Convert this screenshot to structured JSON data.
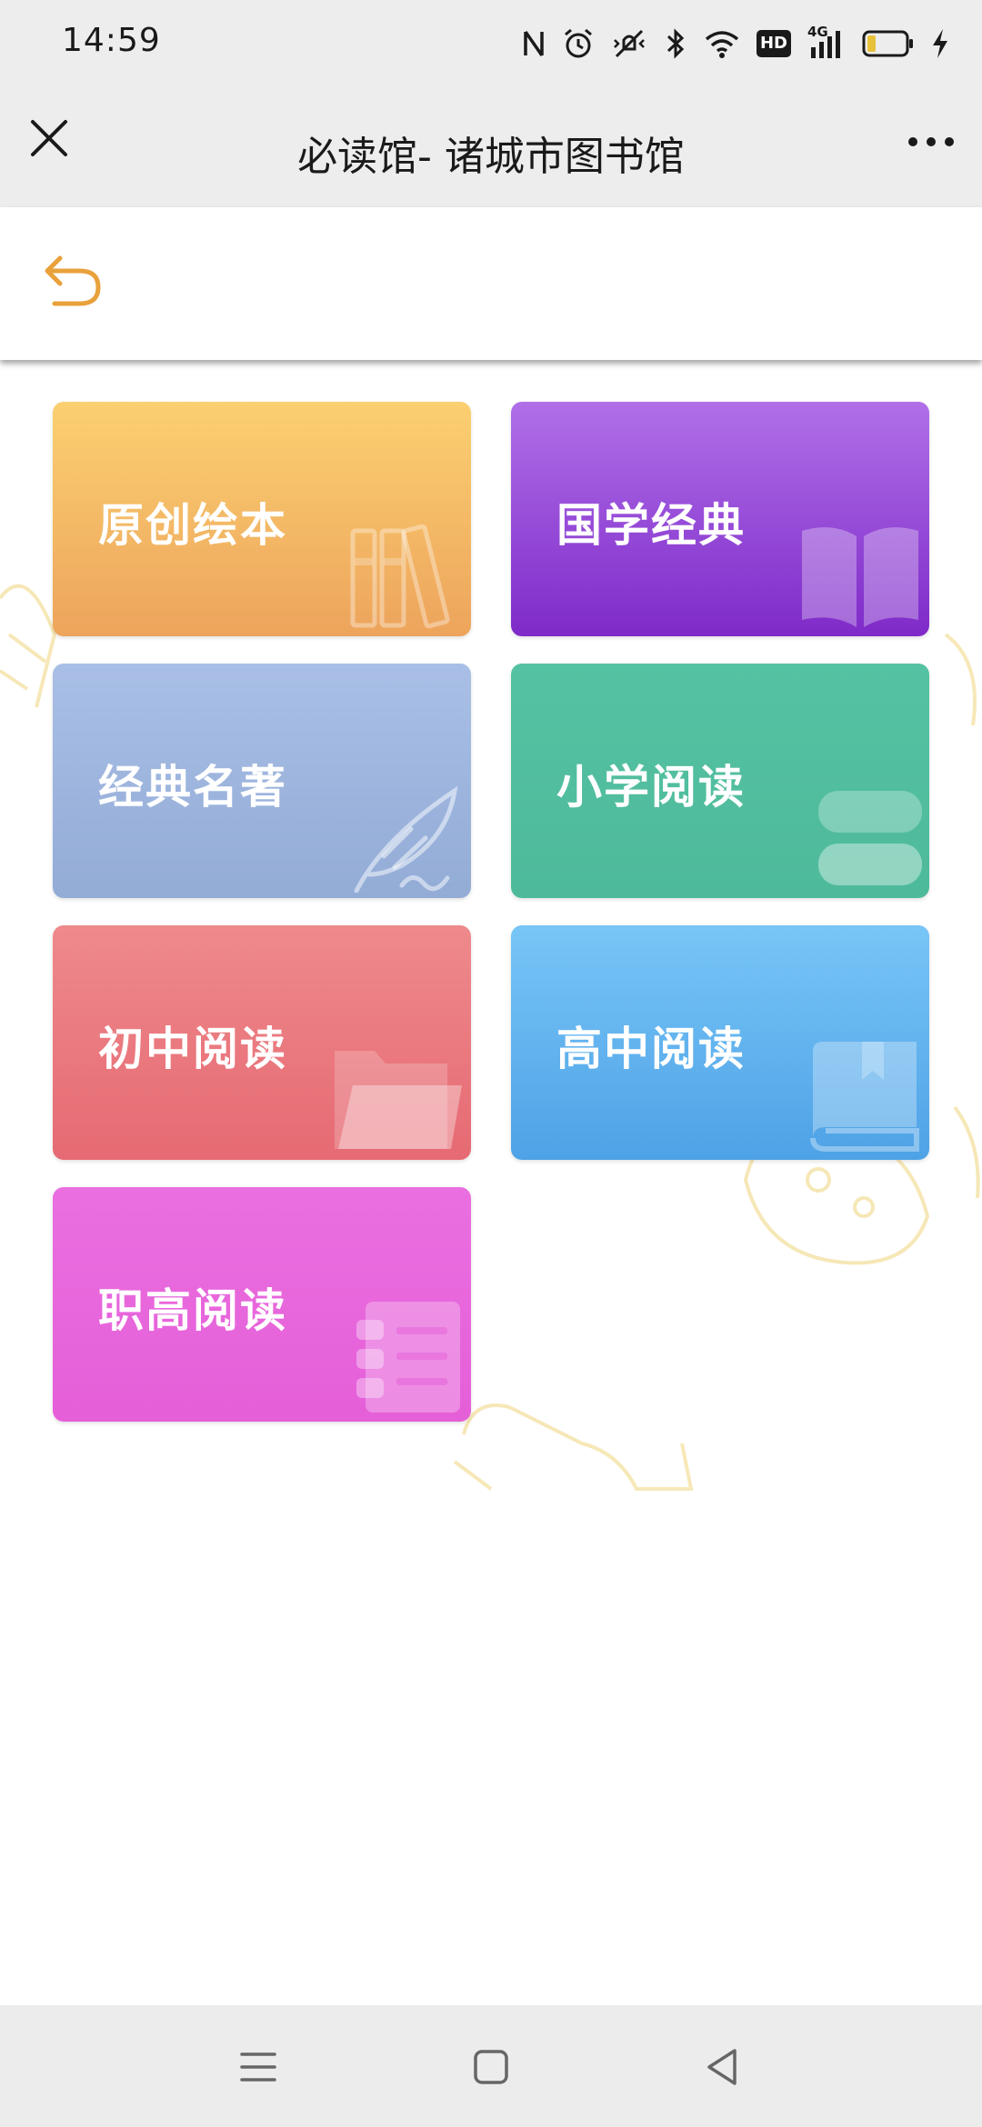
{
  "status_bar": {
    "time": "14:59",
    "icons": [
      "nfc-icon",
      "alarm-icon",
      "vibrate-icon",
      "bluetooth-icon",
      "wifi-icon",
      "hd-icon",
      "signal-4g-icon",
      "battery-icon",
      "charging-icon"
    ],
    "hd_label": "HD",
    "network_label": "4G"
  },
  "title_bar": {
    "title": "必读馆- 诸城市图书馆"
  },
  "toolbar": {
    "back_icon": "undo-arrow-icon",
    "accent_color": "#e9a13b"
  },
  "tiles": [
    {
      "label": "原创绘本",
      "icon": "books-icon",
      "color": "#f0b062"
    },
    {
      "label": "国学经典",
      "icon": "open-book-icon",
      "color": "#9a4cd9"
    },
    {
      "label": "经典名著",
      "icon": "quill-icon",
      "color": "#9fb6df"
    },
    {
      "label": "小学阅读",
      "icon": "book-stack-icon",
      "color": "#52be9f"
    },
    {
      "label": "初中阅读",
      "icon": "folder-icon",
      "color": "#ea7a80"
    },
    {
      "label": "高中阅读",
      "icon": "bookmarked-book-icon",
      "color": "#62b3ef"
    },
    {
      "label": "职高阅读",
      "icon": "notebook-icon",
      "color": "#e767dc"
    }
  ],
  "nav_bar": {
    "icons": [
      "menu-icon",
      "home-square-icon",
      "back-triangle-icon"
    ]
  }
}
